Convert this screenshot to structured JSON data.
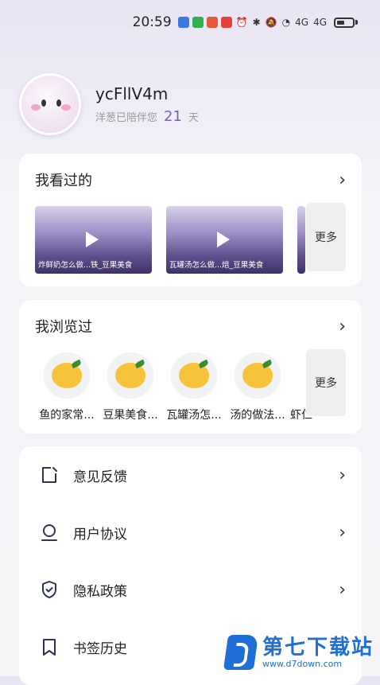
{
  "status_bar": {
    "time": "20:59",
    "signal_a": "4G",
    "signal_b": "4G"
  },
  "profile": {
    "username": "ycFllV4m",
    "companion_prefix": "洋葱已陪伴您",
    "days": "21",
    "days_unit": "天"
  },
  "watched": {
    "title": "我看过的",
    "videos": [
      {
        "caption": "炸鲜奶怎么做...铁_豆果美食"
      },
      {
        "caption": "瓦罐汤怎么做...焙_豆果美食"
      }
    ],
    "more": "更多"
  },
  "browsed": {
    "title": "我浏览过",
    "items": [
      {
        "label": "鱼的家常..."
      },
      {
        "label": "豆果美食..."
      },
      {
        "label": "瓦罐汤怎..."
      },
      {
        "label": "汤的做法..."
      },
      {
        "label": "虾仁"
      }
    ],
    "more": "更多"
  },
  "menu": {
    "items": [
      {
        "label": "意见反馈",
        "icon": "edit-icon"
      },
      {
        "label": "用户协议",
        "icon": "user-icon"
      },
      {
        "label": "隐私政策",
        "icon": "shield-icon"
      },
      {
        "label": "书签历史",
        "icon": "bookmark-icon"
      }
    ]
  },
  "watermark": {
    "title": "第七下载站",
    "url": "www.d7down.com"
  },
  "colors": {
    "accent": "#7c5cc4",
    "watermark": "#1f6fd6",
    "mango": "#f7c33b"
  }
}
